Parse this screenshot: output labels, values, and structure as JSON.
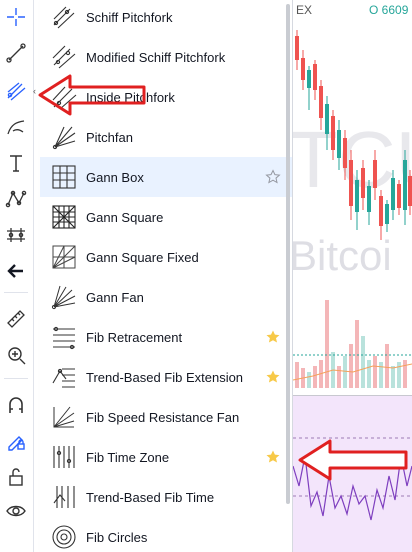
{
  "toolbar": {
    "tools": [
      {
        "name": "crosshair-icon"
      },
      {
        "name": "trend-line-icon"
      },
      {
        "name": "pitchfork-icon"
      },
      {
        "name": "brush-icon"
      },
      {
        "name": "text-icon"
      },
      {
        "name": "pattern-icon"
      },
      {
        "name": "prediction-icon"
      },
      {
        "name": "back-arrow-icon"
      },
      {
        "name": "ruler-icon"
      },
      {
        "name": "zoom-in-icon"
      },
      {
        "name": "magnet-icon"
      },
      {
        "name": "lock-drawing-icon"
      },
      {
        "name": "unlock-icon"
      },
      {
        "name": "eye-icon"
      }
    ]
  },
  "menu": {
    "items": [
      {
        "label": "Schiff Pitchfork",
        "icon": "schiff-pitchfork-icon",
        "starred": false
      },
      {
        "label": "Modified Schiff Pitchfork",
        "icon": "modified-schiff-pitchfork-icon",
        "starred": false
      },
      {
        "label": "Inside Pitchfork",
        "icon": "inside-pitchfork-icon",
        "starred": false
      },
      {
        "label": "Pitchfan",
        "icon": "pitchfan-icon",
        "starred": false
      },
      {
        "label": "Gann Box",
        "icon": "gann-box-icon",
        "starred": false,
        "hovered": true
      },
      {
        "label": "Gann Square",
        "icon": "gann-square-icon",
        "starred": false
      },
      {
        "label": "Gann Square Fixed",
        "icon": "gann-square-fixed-icon",
        "starred": false
      },
      {
        "label": "Gann Fan",
        "icon": "gann-fan-icon",
        "starred": false
      },
      {
        "label": "Fib Retracement",
        "icon": "fib-retracement-icon",
        "starred": true
      },
      {
        "label": "Trend-Based Fib Extension",
        "icon": "fib-extension-icon",
        "starred": true
      },
      {
        "label": "Fib Speed Resistance Fan",
        "icon": "fib-speed-fan-icon",
        "starred": false
      },
      {
        "label": "Fib Time Zone",
        "icon": "fib-time-zone-icon",
        "starred": true
      },
      {
        "label": "Trend-Based Fib Time",
        "icon": "fib-time-icon",
        "starred": false
      },
      {
        "label": "Fib Circles",
        "icon": "fib-circles-icon",
        "starred": false
      }
    ]
  },
  "chart": {
    "symbol": "EX",
    "price": "O 6609",
    "watermark_top": "TCU",
    "watermark_bottom": "Bitcoi"
  },
  "colors": {
    "accent": "#2962ff",
    "star": "#f7c948",
    "bull": "#26a69a",
    "bear": "#ef5350",
    "arrow": "#e02020"
  }
}
